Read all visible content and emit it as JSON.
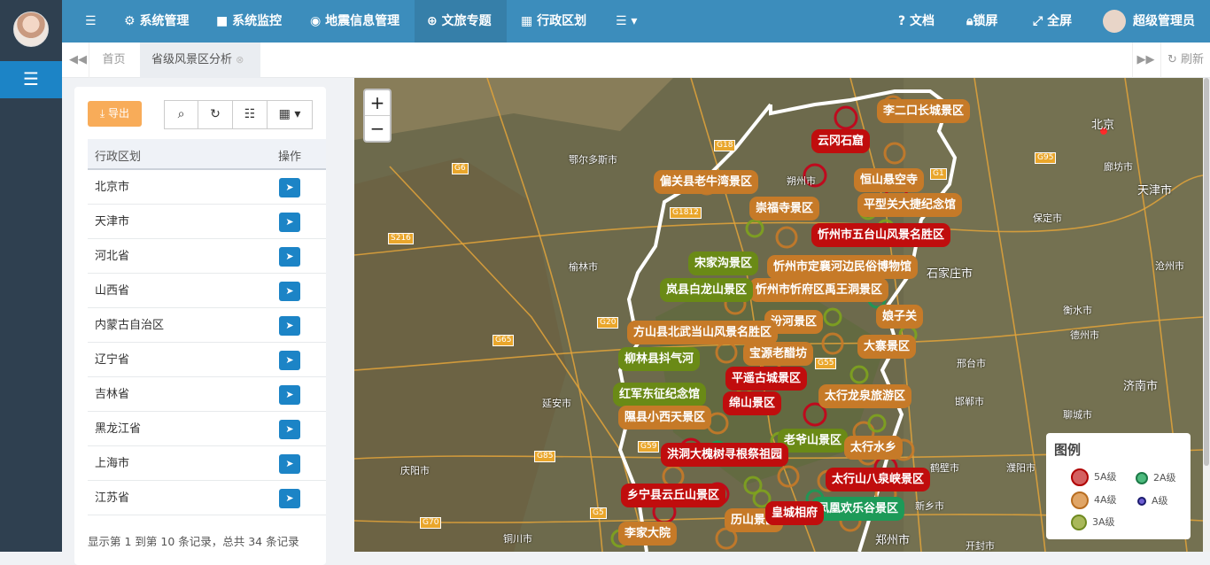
{
  "nav": {
    "items": [
      "系统管理",
      "系统监控",
      "地震信息管理",
      "文旅专题",
      "行政区划"
    ],
    "right": [
      "文档",
      "锁屏",
      "全屏",
      "超级管理员"
    ]
  },
  "tabs": {
    "home": "首页",
    "active": "省级风景区分析",
    "refresh": "刷新"
  },
  "panel": {
    "export_label": "导出",
    "col_region": "行政区划",
    "col_op": "操作",
    "rows": [
      "北京市",
      "天津市",
      "河北省",
      "山西省",
      "内蒙古自治区",
      "辽宁省",
      "吉林省",
      "黑龙江省",
      "上海市",
      "江苏省"
    ],
    "footer": "显示第 1 到第 10 条记录，总共 34 条记录"
  },
  "map": {
    "zoom_in": "+",
    "zoom_out": "−",
    "labels": [
      "李二口长城景区",
      "云冈石窟",
      "偏关县老牛湾景区",
      "恒山悬空寺",
      "崇福寺景区",
      "平型关大捷纪念馆",
      "忻州市五台山风景名胜区",
      "宋家沟景区",
      "忻州市忻府区禹王洞景区",
      "忻州市定襄河边民俗博物馆",
      "岚县白龙山景区",
      "娘子关",
      "汾河景区",
      "方山县北武当山风景名胜区",
      "大寨景区",
      "宝源老醋坊",
      "柳林县抖气河",
      "平遥古城景区",
      "太行龙泉旅游区",
      "红军东征纪念馆",
      "绵山景区",
      "隰县小西天景区",
      "老爷山景区",
      "太行水乡",
      "洪洞大槐树寻根祭祖园",
      "太行山八泉峡景区",
      "乡宁县云丘山景区",
      "凤凰欢乐谷景区",
      "历山景区",
      "皇城相府",
      "李家大院"
    ],
    "cities": [
      "北京",
      "天津市",
      "廊坊市",
      "保定市",
      "沧州市",
      "石家庄市",
      "衡水市",
      "德州市",
      "邢台市",
      "济南市",
      "邯郸市",
      "聊城市",
      "濮阳市",
      "鹤壁市",
      "新乡市",
      "郑州市",
      "开封市",
      "鄂尔多斯市",
      "榆林市",
      "延安市",
      "庆阳市",
      "铜川市",
      "朔州市"
    ],
    "roads": [
      "G18",
      "G6",
      "G95",
      "G1812",
      "S216",
      "G20",
      "G65",
      "G55",
      "G59",
      "G85",
      "G5",
      "G70",
      "G1"
    ]
  },
  "legend": {
    "title": "图例",
    "items": [
      "5A级",
      "2A级",
      "4A级",
      "A级",
      "3A级"
    ]
  }
}
